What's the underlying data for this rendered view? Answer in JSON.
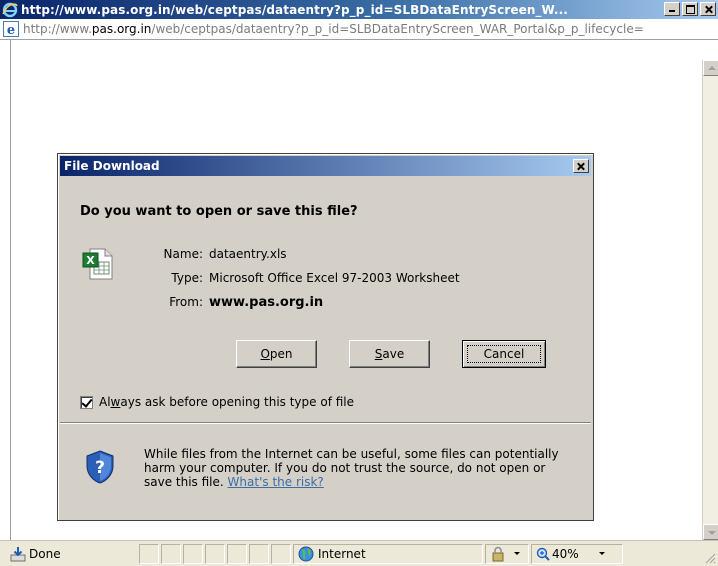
{
  "window": {
    "title": "http://www.pas.org.in/web/ceptpas/dataentry?p_p_id=SLBDataEntryScreen_W..."
  },
  "address": {
    "url_prefix": "http://www.",
    "url_domain": "pas.org.in",
    "url_rest": "/web/ceptpas/dataentry?p_p_id=SLBDataEntryScreen_WAR_Portal&p_p_lifecycle="
  },
  "dialog": {
    "title": "File Download",
    "question": "Do you want to open or save this file?",
    "name_label": "Name:",
    "name_value": "dataentry.xls",
    "type_label": "Type:",
    "type_value": "Microsoft Office Excel 97-2003 Worksheet",
    "from_label": "From:",
    "from_value": "www.pas.org.in",
    "open_label_u": "O",
    "open_label_rest": "pen",
    "save_label_u": "S",
    "save_label_rest": "ave",
    "cancel_label": "Cancel",
    "checkbox_pre": "Al",
    "checkbox_u": "w",
    "checkbox_post": "ays ask before opening this type of file",
    "checkbox_checked": true,
    "warning_text": "While files from the Internet can be useful, some files can potentially harm your computer. If you do not trust the source, do not open or save this file.",
    "risk_link": "What's the risk?"
  },
  "statusbar": {
    "status": "Done",
    "zone": "Internet",
    "zoom": "40%"
  },
  "colors": {
    "titlebar_start": "#0a246a",
    "titlebar_end": "#a6caf0",
    "dialog_face": "#d4d0c8",
    "link": "#3a6ea5"
  }
}
